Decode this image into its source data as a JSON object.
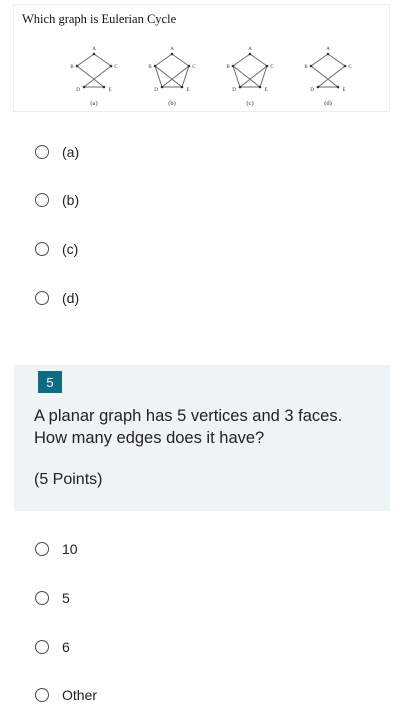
{
  "question4": {
    "figure": {
      "title": "Which graph is Eulerian Cycle",
      "vertex_labels": [
        "A",
        "B",
        "C",
        "D",
        "E"
      ],
      "graphs": [
        {
          "caption": "(a)",
          "edges": [
            [
              "A",
              "B"
            ],
            [
              "A",
              "C"
            ],
            [
              "B",
              "E"
            ],
            [
              "C",
              "D"
            ],
            [
              "D",
              "E"
            ]
          ]
        },
        {
          "caption": "(b)",
          "edges": [
            [
              "A",
              "B"
            ],
            [
              "A",
              "C"
            ],
            [
              "B",
              "D"
            ],
            [
              "B",
              "E"
            ],
            [
              "C",
              "D"
            ],
            [
              "C",
              "E"
            ],
            [
              "D",
              "E"
            ]
          ]
        },
        {
          "caption": "(c)",
          "edges": [
            [
              "A",
              "B"
            ],
            [
              "A",
              "C"
            ],
            [
              "B",
              "D"
            ],
            [
              "B",
              "E"
            ],
            [
              "C",
              "D"
            ],
            [
              "C",
              "E"
            ],
            [
              "D",
              "E"
            ]
          ]
        },
        {
          "caption": "(d)",
          "edges": [
            [
              "A",
              "B"
            ],
            [
              "A",
              "C"
            ],
            [
              "B",
              "E"
            ],
            [
              "C",
              "D"
            ],
            [
              "D",
              "E"
            ]
          ]
        }
      ]
    },
    "options": [
      "(a)",
      "(b)",
      "(c)",
      "(d)"
    ]
  },
  "question5": {
    "number": "5",
    "text": "A planar graph has 5 vertices and 3 faces. How many edges does it have?",
    "points": "(5 Points)",
    "options": [
      "10",
      "5",
      "6",
      "Other"
    ]
  }
}
